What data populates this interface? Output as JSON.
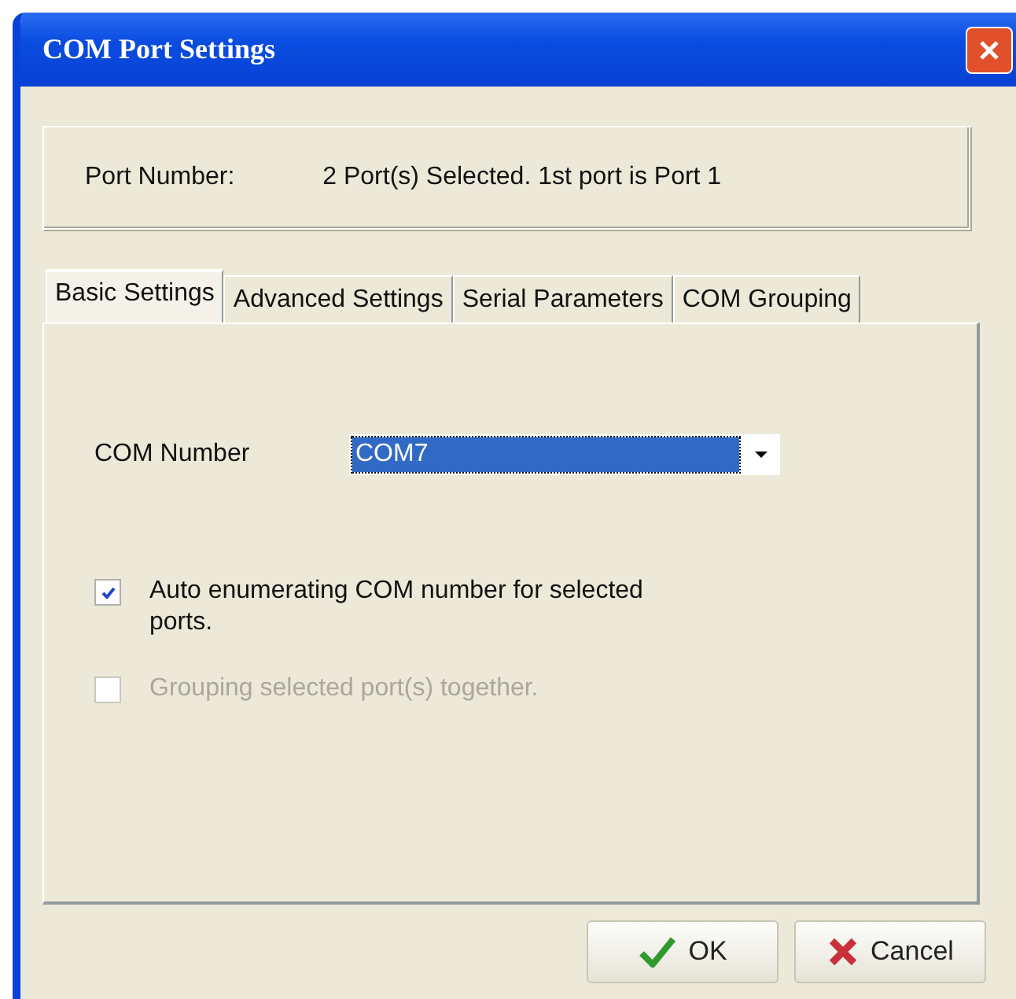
{
  "window": {
    "title": "COM Port Settings"
  },
  "port_number": {
    "label": "Port Number:",
    "value": "2 Port(s) Selected. 1st port is Port 1"
  },
  "tabs": [
    {
      "label": "Basic Settings",
      "selected": true
    },
    {
      "label": "Advanced Settings",
      "selected": false
    },
    {
      "label": "Serial Parameters",
      "selected": false
    },
    {
      "label": "COM Grouping",
      "selected": false
    }
  ],
  "com_number": {
    "label": "COM Number",
    "value": "COM7"
  },
  "options": [
    {
      "label": "Auto enumerating COM number for selected ports.",
      "checked": true,
      "disabled": false
    },
    {
      "label": "Grouping selected port(s) together.",
      "checked": false,
      "disabled": true
    }
  ],
  "buttons": [
    {
      "kind": "ok",
      "label": "OK"
    },
    {
      "kind": "cancel",
      "label": "Cancel"
    }
  ]
}
